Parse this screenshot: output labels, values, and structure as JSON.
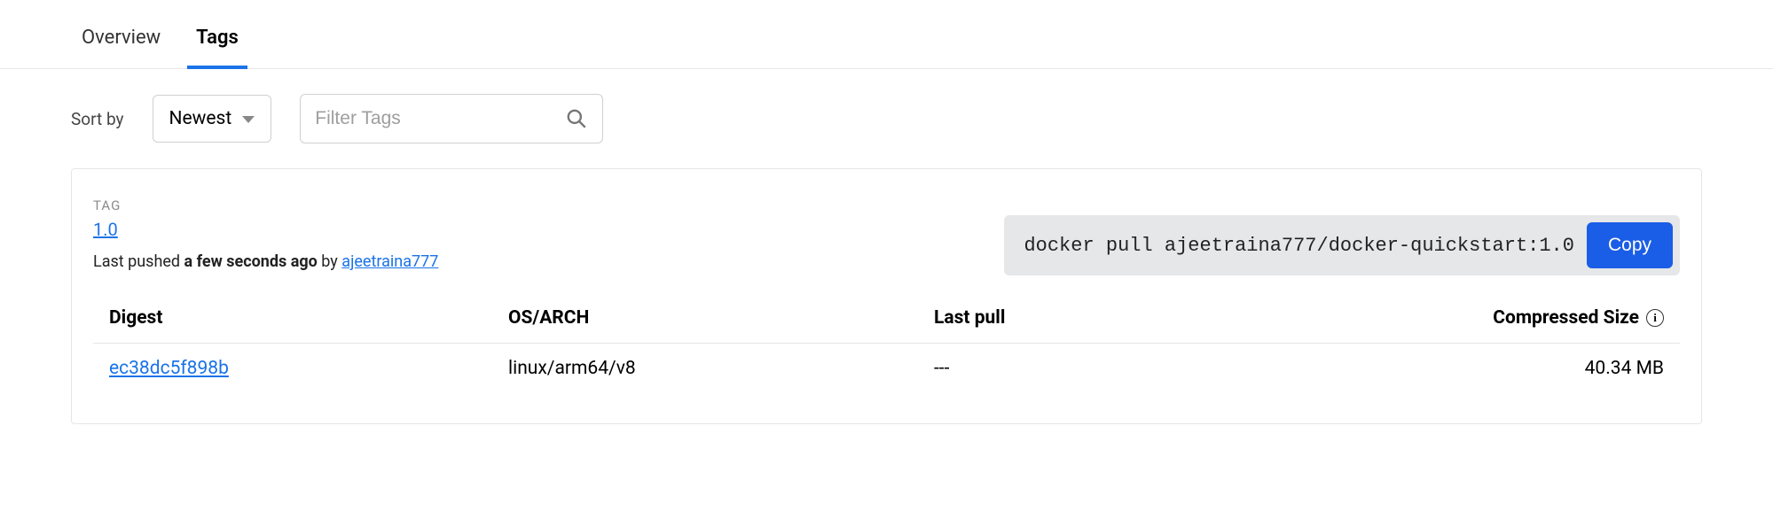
{
  "tabs": {
    "overview": "Overview",
    "tags": "Tags"
  },
  "controls": {
    "sort_label": "Sort by",
    "sort_value": "Newest",
    "filter_placeholder": "Filter Tags"
  },
  "tag": {
    "label": "TAG",
    "version": "1.0",
    "last_pushed_prefix": "Last pushed ",
    "last_pushed_time": "a few seconds ago",
    "by": " by ",
    "user": "ajeetraina777",
    "pull_cmd": "docker pull ajeetraina777/docker-quickstart:1.0",
    "copy_label": "Copy"
  },
  "table": {
    "headers": {
      "digest": "Digest",
      "osarch": "OS/ARCH",
      "lastpull": "Last pull",
      "size": "Compressed Size"
    },
    "row": {
      "digest": "ec38dc5f898b",
      "osarch": "linux/arm64/v8",
      "lastpull": "---",
      "size": "40.34 MB"
    }
  }
}
